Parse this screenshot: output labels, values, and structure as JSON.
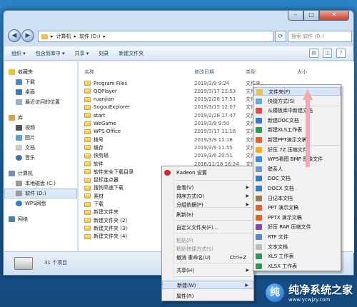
{
  "address": {
    "crumbs": [
      "计算机",
      "软件 (D:)"
    ],
    "sep": "▸"
  },
  "search": {
    "placeholder": "搜索 软件 (D:)"
  },
  "toolbar": {
    "organize": "组织 ▾",
    "include": "包含到库中 ▾",
    "share": "共享 ▾",
    "burn": "刻录",
    "new_folder": "新建文件夹"
  },
  "nav": {
    "favorites": "收藏夹",
    "downloads": "下载",
    "desktop": "桌面",
    "recent": "最近访问的位置",
    "libraries": "库",
    "videos": "视频",
    "pictures": "图片",
    "documents": "文档",
    "music": "音乐",
    "computer": "计算机",
    "local_c": "本地磁盘 (C:)",
    "soft_d": "软件 (D:)",
    "wps": "WPS网盘",
    "network": "网络"
  },
  "columns": {
    "name": "名称",
    "date": "修改日期",
    "type": "类型",
    "size": "大小"
  },
  "files": [
    {
      "name": "Program Files",
      "date": "2019/3/9 9:24",
      "type": "文件夹"
    },
    {
      "name": "QQPlayer",
      "date": "2019/3/17 21:53",
      "type": "文件夹"
    },
    {
      "name": "ruanjian",
      "date": "2019/2/28 17:51",
      "type": "文件夹"
    },
    {
      "name": "SogouExplorer",
      "date": "2019/3/15 12:07",
      "type": "文件夹"
    },
    {
      "name": "start",
      "date": "2019/2/28 17:47",
      "type": "文件夹"
    },
    {
      "name": "WeGame",
      "date": "2019/3/9 9:50",
      "type": "文件夹"
    },
    {
      "name": "WPS Office",
      "date": "2019/3/17 11:16",
      "type": "文件夹"
    },
    {
      "name": "拨号",
      "date": "2019/3/9 11:18",
      "type": "文件夹"
    },
    {
      "name": "缓存",
      "date": "2019/3/9 11:55",
      "type": "文件夹"
    },
    {
      "name": "快剪辑",
      "date": "2019/3/6 20:51",
      "type": "文件夹"
    },
    {
      "name": "软件",
      "date": "2018/11/18 16:24",
      "type": "文件夹"
    },
    {
      "name": "软件安全下载目录",
      "date": "",
      "type": ""
    },
    {
      "name": "鼠标连点器",
      "date": "",
      "type": ""
    },
    {
      "name": "搜狗高速下载",
      "date": "",
      "type": ""
    },
    {
      "name": "素材",
      "date": "",
      "type": ""
    },
    {
      "name": "下载",
      "date": "",
      "type": ""
    },
    {
      "name": "新建文件夹",
      "date": "",
      "type": ""
    },
    {
      "name": "新建文件夹 (2)",
      "date": "",
      "type": ""
    },
    {
      "name": "新建文件夹 (3)",
      "date": "",
      "type": ""
    },
    {
      "name": "新建文件夹 (4)",
      "date": "",
      "type": ""
    }
  ],
  "status": {
    "count": "31 个项目"
  },
  "context_menu": {
    "header": "Radeon 设置",
    "items": [
      {
        "label": "查看(V)",
        "arrow": true
      },
      {
        "label": "排序方式(O)",
        "arrow": true
      },
      {
        "label": "分组依据(P)",
        "arrow": true
      },
      {
        "label": "刷新(E)"
      },
      {
        "label": "自定义文件夹(F)..."
      },
      {
        "label": "粘贴(P)",
        "disabled": true
      },
      {
        "label": "粘贴快捷方式(S)",
        "disabled": true
      },
      {
        "label": "撤消 重命名(U)",
        "shortcut": "Ctrl+Z"
      },
      {
        "label": "共享(H)",
        "arrow": true
      },
      {
        "label": "新建(W)",
        "arrow": true,
        "highlight": true
      },
      {
        "label": "属性(R)"
      }
    ]
  },
  "submenu": {
    "items": [
      {
        "label": "文件夹(F)",
        "color": "#f0c14b",
        "highlight": true
      },
      {
        "label": "快捷方式(S)",
        "color": "#6aa7de"
      },
      {
        "label": "从模板库中新建文档",
        "color": "#e24a3b"
      },
      {
        "label": "新建DOC文档",
        "color": "#3a78c9"
      },
      {
        "label": "新建XLS工作表",
        "color": "#2f9a4f"
      },
      {
        "label": "新建PPT演示文稿",
        "color": "#e0652d"
      },
      {
        "label": "好压 7Z 压缩文件",
        "color": "#f2b01e"
      },
      {
        "label": "WPS看图 BMP 图像文件",
        "color": "#3c8de0"
      },
      {
        "label": "联系人",
        "color": "#6b9ad1"
      },
      {
        "label": "DOC 文档",
        "color": "#3a78c9"
      },
      {
        "label": "DOCX 文档",
        "color": "#3a78c9"
      },
      {
        "label": "日记本文档",
        "color": "#9a7c52"
      },
      {
        "label": "PPT 演示文稿",
        "color": "#e0652d"
      },
      {
        "label": "PPTX 演示文稿",
        "color": "#e0652d"
      },
      {
        "label": "好压 RAR 压缩文件",
        "color": "#8e44ad"
      },
      {
        "label": "RTF 文件",
        "color": "#5a87c5"
      },
      {
        "label": "文本文档",
        "color": "#bdbdbd"
      },
      {
        "label": "XLS 工作表",
        "color": "#2f9a4f"
      },
      {
        "label": "XLSX 工作表",
        "color": "#2f9a4f"
      }
    ]
  },
  "watermark": {
    "title": "纯净系统之家",
    "url": "www.ycwjzy.com"
  }
}
